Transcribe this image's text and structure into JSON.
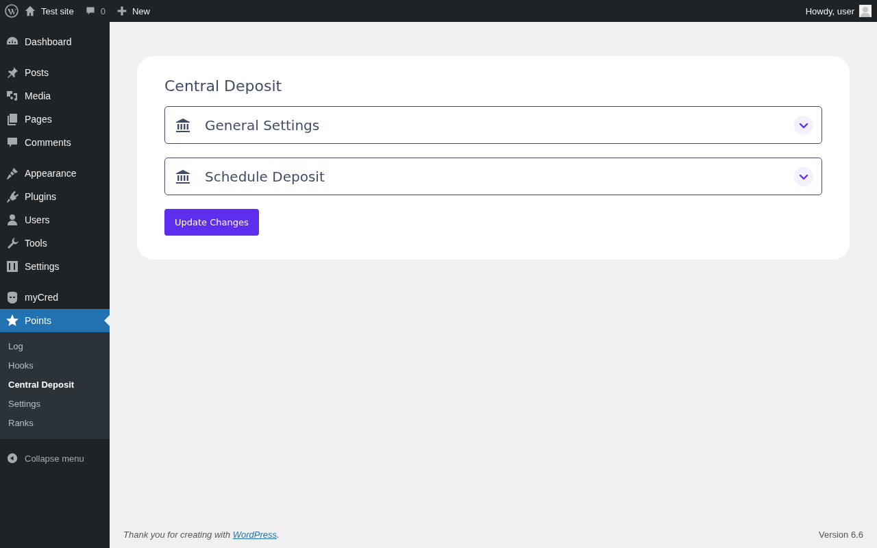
{
  "admin_bar": {
    "site_name": "Test site",
    "comments_count": "0",
    "new_label": "New",
    "greeting": "Howdy, user"
  },
  "sidebar": {
    "menu_groups": [
      [
        {
          "label": "Dashboard",
          "selected": false
        }
      ],
      [
        {
          "label": "Posts",
          "selected": false
        },
        {
          "label": "Media",
          "selected": false
        },
        {
          "label": "Pages",
          "selected": false
        },
        {
          "label": "Comments",
          "selected": false
        }
      ],
      [
        {
          "label": "Appearance",
          "selected": false
        },
        {
          "label": "Plugins",
          "selected": false
        },
        {
          "label": "Users",
          "selected": false
        },
        {
          "label": "Tools",
          "selected": false
        },
        {
          "label": "Settings",
          "selected": false
        }
      ],
      [
        {
          "label": "myCred",
          "selected": false
        },
        {
          "label": "Points",
          "selected": true,
          "submenu": [
            {
              "label": "Log",
              "selected": false
            },
            {
              "label": "Hooks",
              "selected": false
            },
            {
              "label": "Central Deposit",
              "selected": true
            },
            {
              "label": "Settings",
              "selected": false
            },
            {
              "label": "Ranks",
              "selected": false
            }
          ]
        }
      ]
    ],
    "collapse_label": "Collapse menu"
  },
  "page": {
    "title": "Central Deposit",
    "sections": [
      {
        "title": "General Settings",
        "expanded": false
      },
      {
        "title": "Schedule Deposit",
        "expanded": false
      }
    ],
    "button": "Update Changes"
  },
  "footer": {
    "thanks_prefix": "Thank you for creating with ",
    "thanks_link": "WordPress",
    "thanks_suffix": ".",
    "version": "Version 6.6"
  }
}
